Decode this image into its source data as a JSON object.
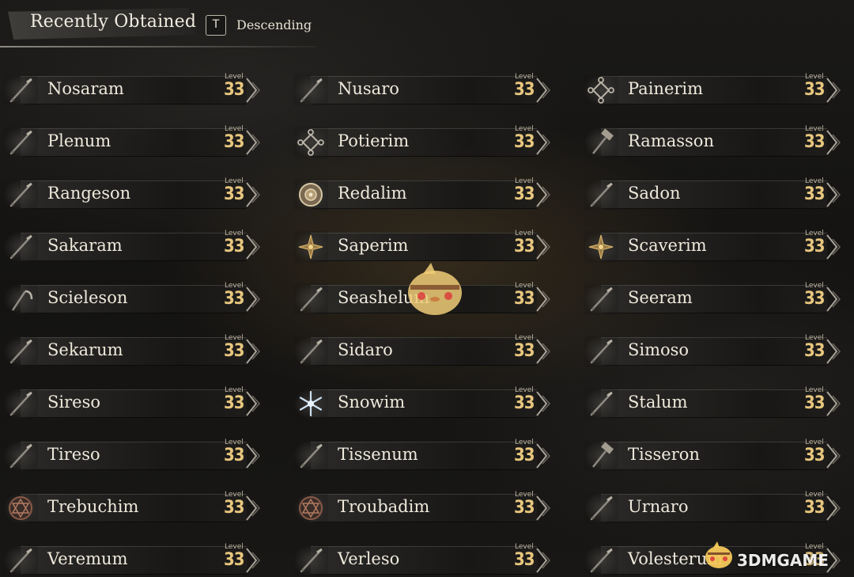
{
  "header": {
    "title": "Recently Obtained",
    "sort_key": "T",
    "sort_label": "Descending"
  },
  "level_label": "Level",
  "columns": [
    [
      {
        "name": "Nosaram",
        "level": "33",
        "icon": "staff-icon"
      },
      {
        "name": "Plenum",
        "level": "33",
        "icon": "staff-icon"
      },
      {
        "name": "Rangeson",
        "level": "33",
        "icon": "staff-icon"
      },
      {
        "name": "Sakaram",
        "level": "33",
        "icon": "staff-icon"
      },
      {
        "name": "Scieleson",
        "level": "33",
        "icon": "scythe-icon"
      },
      {
        "name": "Sekarum",
        "level": "33",
        "icon": "staff-icon"
      },
      {
        "name": "Sireso",
        "level": "33",
        "icon": "staff-icon"
      },
      {
        "name": "Tireso",
        "level": "33",
        "icon": "staff-icon"
      },
      {
        "name": "Trebuchim",
        "level": "33",
        "icon": "rune-disc-icon"
      },
      {
        "name": "Veremum",
        "level": "33",
        "icon": "staff-icon"
      }
    ],
    [
      {
        "name": "Nusaro",
        "level": "33",
        "icon": "staff-icon"
      },
      {
        "name": "Potierim",
        "level": "33",
        "icon": "knot-charm-icon"
      },
      {
        "name": "Redalim",
        "level": "33",
        "icon": "round-shield-icon"
      },
      {
        "name": "Saperim",
        "level": "33",
        "icon": "star-charm-icon"
      },
      {
        "name": "Seashelum",
        "level": "33",
        "icon": "staff-icon"
      },
      {
        "name": "Sidaro",
        "level": "33",
        "icon": "staff-icon"
      },
      {
        "name": "Snowim",
        "level": "33",
        "icon": "snowflake-icon"
      },
      {
        "name": "Tissenum",
        "level": "33",
        "icon": "staff-icon"
      },
      {
        "name": "Troubadim",
        "level": "33",
        "icon": "rune-disc-icon"
      },
      {
        "name": "Verleso",
        "level": "33",
        "icon": "staff-icon"
      }
    ],
    [
      {
        "name": "Painerim",
        "level": "33",
        "icon": "knot-charm-icon"
      },
      {
        "name": "Ramasson",
        "level": "33",
        "icon": "hammer-icon"
      },
      {
        "name": "Sadon",
        "level": "33",
        "icon": "staff-icon"
      },
      {
        "name": "Scaverim",
        "level": "33",
        "icon": "star-charm-icon"
      },
      {
        "name": "Seeram",
        "level": "33",
        "icon": "staff-icon"
      },
      {
        "name": "Simoso",
        "level": "33",
        "icon": "staff-icon"
      },
      {
        "name": "Stalum",
        "level": "33",
        "icon": "staff-icon"
      },
      {
        "name": "Tisseron",
        "level": "33",
        "icon": "hammer-icon"
      },
      {
        "name": "Urnaro",
        "level": "33",
        "icon": "staff-icon"
      },
      {
        "name": "Volesterum",
        "level": "33",
        "icon": "staff-icon"
      }
    ]
  ],
  "watermark": "3DMGAME",
  "colors": {
    "level_value": "#e7c67e",
    "item_text": "#efe9dc"
  }
}
